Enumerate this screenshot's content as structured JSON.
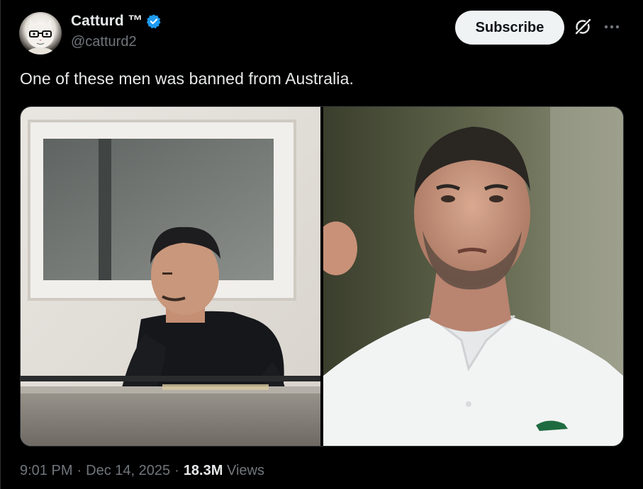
{
  "author": {
    "display_name": "Catturd ™",
    "handle": "@catturd2",
    "verified": true,
    "avatar_icon": "cat-with-glasses-avatar"
  },
  "actions": {
    "subscribe_label": "Subscribe",
    "grok_icon": "grok-icon",
    "more_icon": "more-icon"
  },
  "tweet": {
    "text": "One of these men was banned from Australia.",
    "images": [
      {
        "icon": "photo-man-on-balcony"
      },
      {
        "icon": "photo-tennis-player"
      }
    ]
  },
  "meta": {
    "time": "9:01 PM",
    "separator": "·",
    "date": "Dec 14, 2025",
    "views_count": "18.3M",
    "views_label": "Views"
  },
  "colors": {
    "background": "#000000",
    "text_primary": "#e7e9ea",
    "text_secondary": "#71767b",
    "verified_blue": "#1d9bf0",
    "button_bg": "#eff3f4"
  }
}
